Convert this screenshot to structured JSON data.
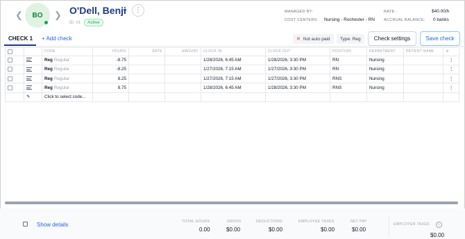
{
  "employee": {
    "initials": "BO",
    "name": "O'Dell, Benji",
    "id_text": "ID: #1",
    "status": "Active"
  },
  "meta": {
    "managed_by_label": "MANAGED BY:",
    "managed_by_value": "",
    "cost_centers_label": "COST CENTERS:",
    "cost_centers_value": "Nursing - Rochester - RN",
    "rate_label": "RATE:",
    "rate_value": "$40.00/h",
    "accrual_label": "ACCRUAL BALANCE:",
    "accrual_value": "0 banks"
  },
  "tabs": {
    "active": "CHECK 1",
    "add": "+ Add check"
  },
  "toolbar": {
    "not_auto_paid": "Not auto paid",
    "type": "Type: Reg",
    "check_settings": "Check settings",
    "save_check": "Save check"
  },
  "table": {
    "headers": [
      "CODE",
      "HOURS",
      "RATE",
      "AMOUNT",
      "CLOCK IN",
      "CLOCK OUT",
      "POSITION",
      "DEPARTMENT",
      "PATIENT NAME"
    ],
    "rows": [
      {
        "code": "Reg",
        "code_sub": "Regular",
        "hours": "-8.75",
        "rate": "",
        "amount": "",
        "clock_in": "1/28/2026, 6:45 AM",
        "clock_out": "1/28/2026, 3:30 PM",
        "position": "RN",
        "department": "Nursing",
        "patient": ""
      },
      {
        "code": "Reg",
        "code_sub": "Regular",
        "hours": "-8.25",
        "rate": "",
        "amount": "",
        "clock_in": "1/27/2026, 7:15 AM",
        "clock_out": "1/27/2026, 3:30 PM",
        "position": "RN",
        "department": "Nursing",
        "patient": ""
      },
      {
        "code": "Reg",
        "code_sub": "Regular",
        "hours": "8.25",
        "rate": "",
        "amount": "",
        "clock_in": "1/27/2026, 7:15 AM",
        "clock_out": "1/27/2026, 3:30 PM",
        "position": "RNS",
        "department": "Nursing",
        "patient": ""
      },
      {
        "code": "Reg",
        "code_sub": "Regular",
        "hours": "8.75",
        "rate": "",
        "amount": "",
        "clock_in": "1/28/2026, 6:45 AM",
        "clock_out": "1/28/2026, 3:30 PM",
        "position": "RNS",
        "department": "Nursing",
        "patient": ""
      }
    ],
    "new_row_placeholder": "Click to select code..."
  },
  "footer": {
    "show_details": "Show details",
    "total_hours_label": "TOTAL HOURS",
    "total_hours_value": "0.00",
    "gross_label": "GROSS",
    "gross_value": "$0.00",
    "deductions_label": "DEDUCTIONS",
    "deductions_value": "$0.00",
    "employee_taxes_label": "EMPLOYEE TAXES",
    "employee_taxes_value": "$0.00",
    "net_pay_label": "NET PAY",
    "net_pay_value": "$0.00",
    "employer_taxes_label": "EMPLOYER TAXES",
    "employer_taxes_value": "$0.00"
  },
  "colors": {
    "accent": "#1e3a8a",
    "link": "#2563eb",
    "active_green": "#16a34a"
  }
}
